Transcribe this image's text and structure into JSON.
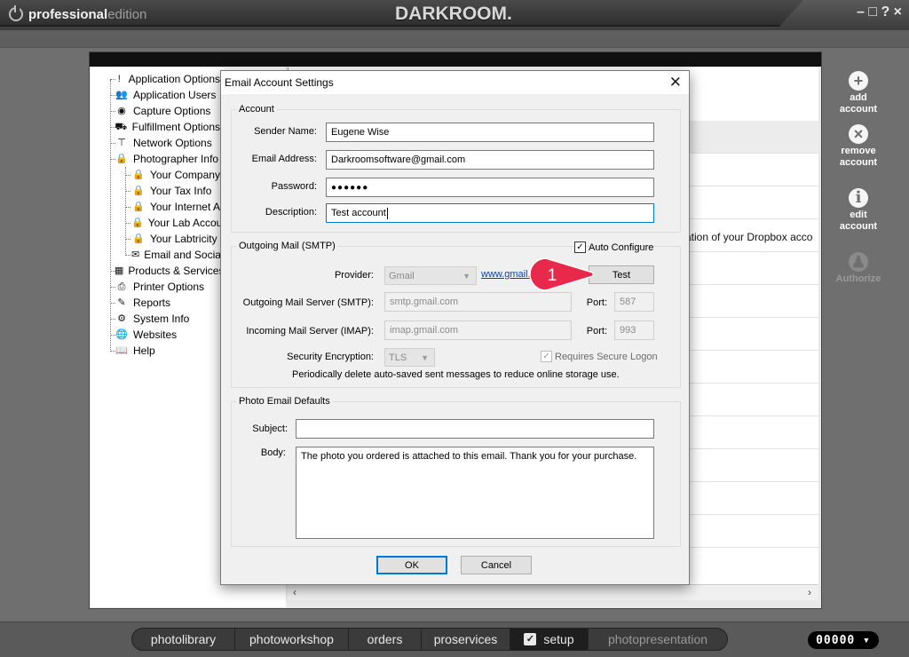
{
  "window": {
    "brand_bold": "professional",
    "brand_light": "edition",
    "app_name": "DARKROOM.",
    "controls": "– □ ? ×"
  },
  "tree": {
    "items": [
      {
        "label": "Application Options",
        "icon": "info-icon",
        "glyph": "!"
      },
      {
        "label": "Application Users",
        "icon": "users-icon",
        "glyph": "👥"
      },
      {
        "label": "Capture Options",
        "icon": "camera-icon",
        "glyph": "◉"
      },
      {
        "label": "Fulfillment Options",
        "icon": "cart-icon",
        "glyph": "⛟"
      },
      {
        "label": "Network Options",
        "icon": "network-icon",
        "glyph": "⊤"
      },
      {
        "label": "Photographer Info",
        "icon": "lock-icon",
        "glyph": "🔒"
      },
      {
        "label": "Your Company",
        "icon": "lock-icon",
        "glyph": "🔒"
      },
      {
        "label": "Your Tax Info",
        "icon": "lock-icon",
        "glyph": "🔒"
      },
      {
        "label": "Your Internet A",
        "icon": "lock-icon",
        "glyph": "🔒"
      },
      {
        "label": "Your Lab Accou",
        "icon": "lock-icon",
        "glyph": "🔒"
      },
      {
        "label": "Your Labtricity",
        "icon": "lock-icon",
        "glyph": "🔒"
      },
      {
        "label": "Email and Socia",
        "icon": "envelope-icon",
        "glyph": "✉"
      },
      {
        "label": "Products & Services",
        "icon": "products-icon",
        "glyph": "▦"
      },
      {
        "label": "Printer Options",
        "icon": "printer-icon",
        "glyph": "⎙"
      },
      {
        "label": "Reports",
        "icon": "reports-icon",
        "glyph": "✎"
      },
      {
        "label": "System Info",
        "icon": "system-icon",
        "glyph": "⚙"
      },
      {
        "label": "Websites",
        "icon": "globe-icon",
        "glyph": "🌐"
      },
      {
        "label": "Help",
        "icon": "help-icon",
        "glyph": "📖"
      }
    ]
  },
  "right_pane": {
    "dropbox_text": "ation of your Dropbox acco"
  },
  "sidebar_actions": {
    "add": {
      "line1": "add",
      "line2": "account",
      "glyph": "+"
    },
    "remove": {
      "line1": "remove",
      "line2": "account",
      "glyph": "×"
    },
    "edit": {
      "line1": "edit",
      "line2": "account",
      "glyph": "i"
    },
    "authorize": {
      "line1": "Authorize",
      "glyph": "♟"
    }
  },
  "dialog": {
    "title": "Email Account Settings",
    "close": "✕",
    "account": {
      "legend": "Account",
      "sender_name_label": "Sender Name:",
      "sender_name": "Eugene Wise",
      "email_label": "Email Address:",
      "email": "Darkroomsoftware@gmail.com",
      "password_label": "Password:",
      "password": "●●●●●●",
      "description_label": "Description:",
      "description": "Test account"
    },
    "smtp": {
      "legend": "Outgoing Mail (SMTP)",
      "auto_configure_label": "Auto Configure",
      "auto_configure_checked": "✓",
      "provider_label": "Provider:",
      "provider": "Gmail",
      "provider_link": "www.gmail.com",
      "test_button": "Test",
      "outgoing_label": "Outgoing Mail Server (SMTP):",
      "outgoing": "smtp.gmail.com",
      "outgoing_port_label": "Port:",
      "outgoing_port": "587",
      "incoming_label": "Incoming Mail Server (IMAP):",
      "incoming": "imap.gmail.com",
      "incoming_port_label": "Port:",
      "incoming_port": "993",
      "security_label": "Security Encryption:",
      "security": "TLS",
      "requires_logon_label": "Requires Secure Logon",
      "requires_logon_checked": "✓",
      "note": "Periodically delete auto-saved sent messages to reduce online storage use."
    },
    "photo_defaults": {
      "legend": "Photo Email Defaults",
      "subject_label": "Subject:",
      "subject": "",
      "body_label": "Body:",
      "body": "The photo you ordered is attached to this email.  Thank you for your purchase."
    },
    "ok_button": "OK",
    "cancel_button": "Cancel"
  },
  "callout": {
    "number": "1",
    "color": "#e8294c"
  },
  "bottom_nav": {
    "tabs": [
      "photolibrary",
      "photoworkshop",
      "orders",
      "proservices",
      "setup",
      "photopresentation"
    ],
    "active": "setup",
    "setup_check": "✓",
    "counter": "00000 ▾"
  }
}
